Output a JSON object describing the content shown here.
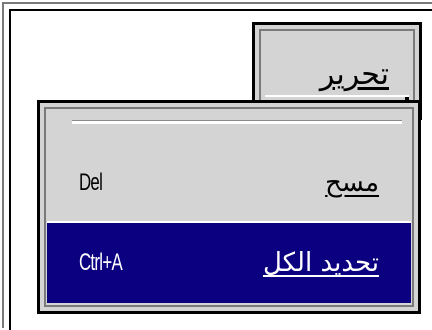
{
  "menu": {
    "title": "تحرير",
    "items": [
      {
        "label": "مسح",
        "shortcut": "Del"
      },
      {
        "label": "تحديد الكل",
        "shortcut": "Ctrl+A",
        "highlighted": true
      }
    ]
  },
  "colors": {
    "menu_bg": "#d4d4d4",
    "highlight_bg": "#0b0080",
    "highlight_text": "#ffffff"
  }
}
